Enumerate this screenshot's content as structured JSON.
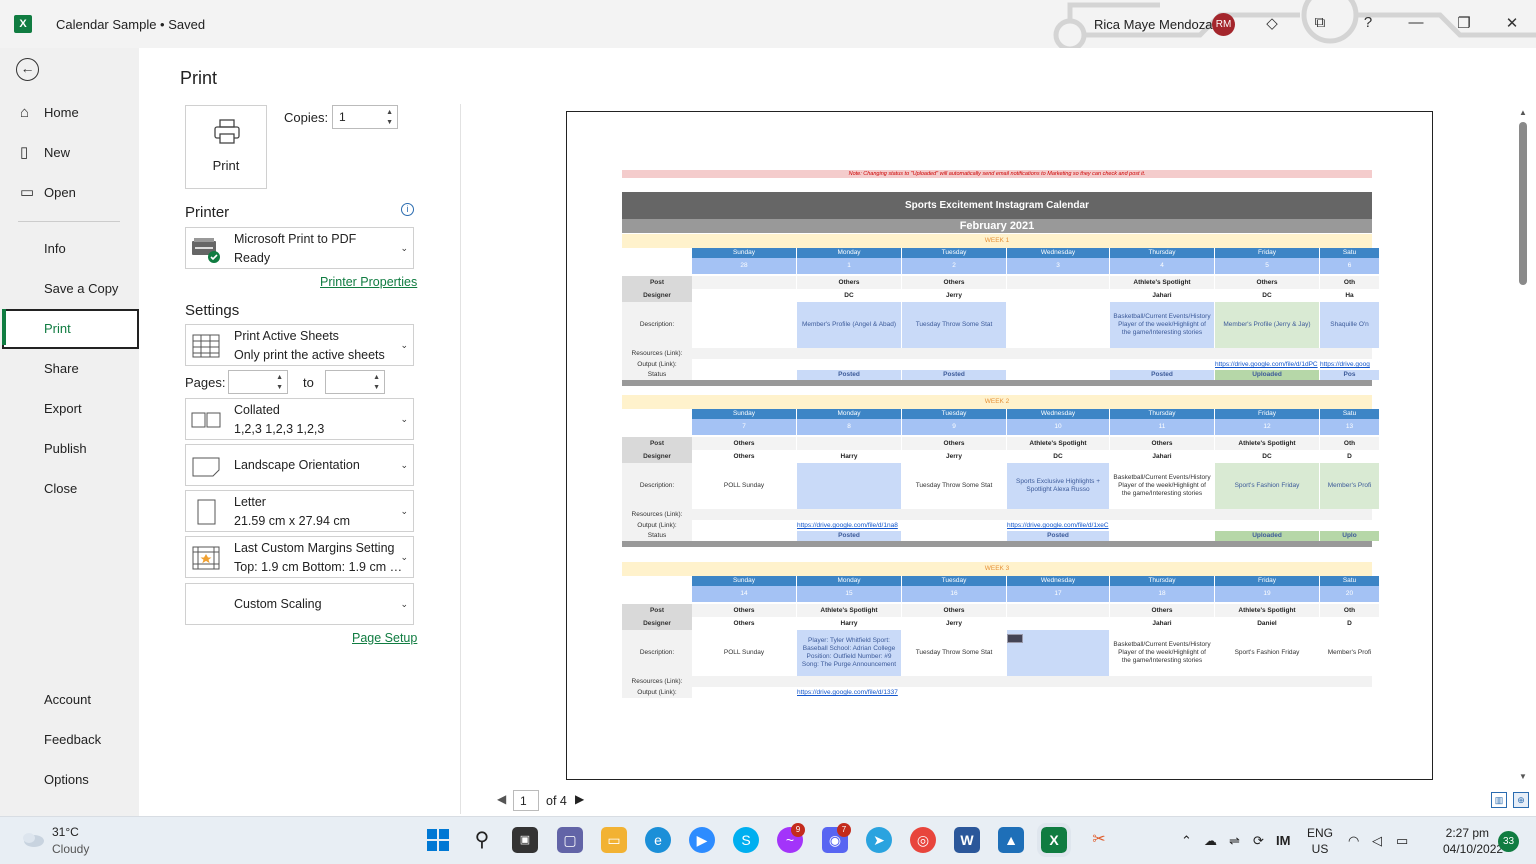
{
  "titlebar": {
    "app_icon": "excel-icon",
    "doc_title": "Calendar Sample • Saved",
    "user_name": "Rica Maye Mendoza",
    "user_initials": "RM",
    "help": "?"
  },
  "nav": {
    "items": [
      {
        "label": "Home",
        "icon": "home-icon"
      },
      {
        "label": "New",
        "icon": "new-document-icon"
      },
      {
        "label": "Open",
        "icon": "folder-icon"
      },
      {
        "label": "Info"
      },
      {
        "label": "Save a Copy"
      },
      {
        "label": "Print",
        "active": true
      },
      {
        "label": "Share"
      },
      {
        "label": "Export"
      },
      {
        "label": "Publish"
      },
      {
        "label": "Close"
      },
      {
        "label": "Account"
      },
      {
        "label": "Feedback"
      },
      {
        "label": "Options"
      }
    ]
  },
  "print": {
    "heading": "Print",
    "print_button": "Print",
    "copies_label": "Copies:",
    "copies_value": "1",
    "printer_heading": "Printer",
    "printer_name": "Microsoft Print to PDF",
    "printer_status": "Ready",
    "printer_properties": "Printer Properties",
    "settings_heading": "Settings",
    "sheets_l1": "Print Active Sheets",
    "sheets_l2": "Only print the active sheets",
    "pages_label": "Pages:",
    "to_label": "to",
    "collated_l1": "Collated",
    "collated_l2": "1,2,3    1,2,3    1,2,3",
    "orientation": "Landscape Orientation",
    "paper_l1": "Letter",
    "paper_l2": "21.59 cm x 27.94 cm",
    "margins_l1": "Last Custom Margins Setting",
    "margins_l2": "Top: 1.9 cm Bottom: 1.9 cm L...",
    "scaling": "Custom Scaling",
    "page_setup": "Page Setup",
    "page_current": "1",
    "page_total": "of 4"
  },
  "sheet": {
    "note": "Note: Changing status to \"Uploaded\" will automatically send email notifications to Marketing so they can check and post it.",
    "title": "Sports Excitement Instagram Calendar",
    "month": "February 2021",
    "days": [
      "Sunday",
      "Monday",
      "Tuesday",
      "Wednesday",
      "Thursday",
      "Friday",
      "Satu"
    ],
    "row_labels": {
      "post": "Post",
      "designer": "Designer",
      "description": "Description:",
      "resources": "Resources (Link):",
      "output": "Output (Link):",
      "status": "Status"
    },
    "weeks": [
      {
        "label": "WEEK 1",
        "dates": [
          "28",
          "1",
          "2",
          "3",
          "4",
          "5",
          "6"
        ],
        "post": [
          "",
          "Others",
          "Others",
          "",
          "Athlete's Spotlight",
          "Others",
          "Oth"
        ],
        "designer": [
          "",
          "DC",
          "Jerry",
          "",
          "Jahari",
          "DC",
          "Ha"
        ],
        "description": [
          "",
          "Member's Profile (Angel & Abad)",
          "Tuesday Throw Some Stat",
          "",
          "Basketball/Current Events/History Player of the week/Highlight of the game/Interesting stories",
          "Member's Profile (Jerry & Jay)",
          "Shaquille O'n"
        ],
        "desc_colors": [
          "",
          "#c9daf8",
          "#c9daf8",
          "",
          "#c9daf8",
          "#d9ead3",
          "#c9daf8"
        ],
        "output": [
          "",
          "",
          "",
          "",
          "",
          "https://drive.google.com/file/d/1dPC",
          "https://drive.goog"
        ],
        "status": [
          "",
          "Posted",
          "Posted",
          "",
          "Posted",
          "Uploaded",
          "Pos"
        ],
        "status_colors": [
          "",
          "#c9daf8",
          "#c9daf8",
          "",
          "#c9daf8",
          "#b6d7a8",
          "#c9daf8"
        ]
      },
      {
        "label": "WEEK 2",
        "dates": [
          "7",
          "8",
          "9",
          "10",
          "11",
          "12",
          "13"
        ],
        "post": [
          "Others",
          "",
          "Others",
          "Athlete's Spotlight",
          "Others",
          "Athlete's Spotlight",
          "Oth"
        ],
        "designer": [
          "Others",
          "Harry",
          "Jerry",
          "DC",
          "Jahari",
          "DC",
          "D"
        ],
        "description": [
          "POLL Sunday",
          "",
          "Tuesday Throw Some Stat",
          "Sports Exclusive Highlights + Spotlight Alexa Russo",
          "Basketball/Current Events/History Player of the week/Highlight of the game/Interesting stories",
          "Sport's Fashion Friday",
          "Member's Profi"
        ],
        "desc_colors": [
          "",
          "#c9daf8",
          "",
          "#c9daf8",
          "",
          "#d9ead3",
          "#d9ead3"
        ],
        "output": [
          "",
          "https://drive.google.com/file/d/1na8",
          "",
          "https://drive.google.com/file/d/1xeC",
          "",
          "",
          ""
        ],
        "status": [
          "",
          "Posted",
          "",
          "Posted",
          "",
          "Uploaded",
          "Uplo"
        ],
        "status_colors": [
          "",
          "#c9daf8",
          "",
          "#c9daf8",
          "",
          "#b6d7a8",
          "#b6d7a8"
        ]
      },
      {
        "label": "WEEK 3",
        "dates": [
          "14",
          "15",
          "16",
          "17",
          "18",
          "19",
          "20"
        ],
        "post": [
          "Others",
          "Athlete's Spotlight",
          "Others",
          "",
          "Others",
          "Athlete's Spotlight",
          "Oth"
        ],
        "designer": [
          "Others",
          "Harry",
          "Jerry",
          "",
          "Jahari",
          "Daniel",
          "D"
        ],
        "description": [
          "POLL Sunday",
          "Player: Tyler Whitfield Sport: Baseball School: Adrian College Position: Outfield Number: #9 Song: The Purge Announcement",
          "Tuesday Throw Some Stat",
          "",
          "Basketball/Current Events/History Player of the week/Highlight of the game/Interesting stories",
          "Sport's Fashion Friday",
          "Member's Profi"
        ],
        "desc_colors": [
          "",
          "#c9daf8",
          "",
          "#c9daf8",
          "",
          "",
          ""
        ],
        "output": [
          "",
          "https://drive.google.com/file/d/1337",
          "",
          "",
          "",
          "",
          ""
        ],
        "status": [
          "",
          "",
          "",
          "",
          "",
          "",
          ""
        ],
        "status_colors": [
          "",
          "",
          "",
          "",
          "",
          "",
          ""
        ]
      }
    ]
  },
  "taskbar": {
    "temperature": "31°C",
    "condition": "Cloudy",
    "messenger_badge": "9",
    "discord_badge": "7",
    "lang_l1": "ENG",
    "lang_l2": "US",
    "time": "2:27 pm",
    "date": "04/10/2022",
    "notifications": "33"
  },
  "colors": {
    "excel_green": "#107c41",
    "sheet_title_bg": "#666666",
    "day_header_bg": "#3d85c6",
    "date_row_bg": "#a4c2f4",
    "week_band_bg": "#fff2cc",
    "note_bg": "#f4cccc"
  }
}
